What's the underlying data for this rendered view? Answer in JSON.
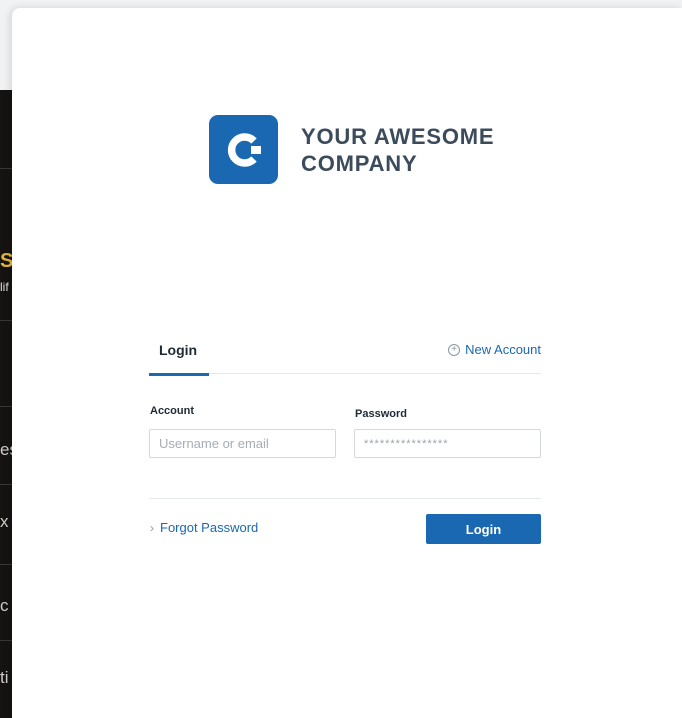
{
  "background": {
    "sidebar_items": [
      "SU",
      "lif",
      "es",
      "x",
      "c",
      "ti"
    ]
  },
  "logo": {
    "line1": "YOUR AWESOME",
    "line2": "COMPANY",
    "brand_color": "#1a68b1"
  },
  "tabs": {
    "login_label": "Login",
    "new_account_label": "New Account"
  },
  "form": {
    "account_label": "Account",
    "account_placeholder": "Username or email",
    "account_value": "",
    "password_label": "Password",
    "password_value": "****************"
  },
  "actions": {
    "forgot_label": "Forgot Password",
    "login_button_label": "Login"
  }
}
